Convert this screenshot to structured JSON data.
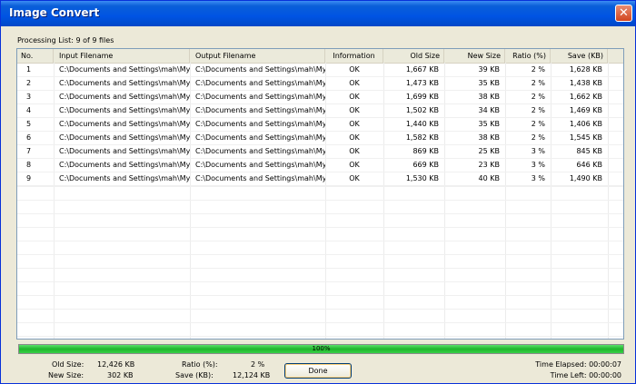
{
  "window": {
    "title": "Image Convert"
  },
  "processing_label": "Processing List: 9 of 9 files",
  "table": {
    "columns": [
      "No.",
      "Input Filename",
      "Output Filename",
      "Information",
      "Old Size",
      "New Size",
      "Ratio (%)",
      "Save (KB)"
    ],
    "rows": [
      [
        "1",
        "C:\\Documents and Settings\\mah\\My ...",
        "C:\\Documents and Settings\\mah\\My ...",
        "OK",
        "1,667 KB",
        "39 KB",
        "2 %",
        "1,628 KB"
      ],
      [
        "2",
        "C:\\Documents and Settings\\mah\\My ...",
        "C:\\Documents and Settings\\mah\\My ...",
        "OK",
        "1,473 KB",
        "35 KB",
        "2 %",
        "1,438 KB"
      ],
      [
        "3",
        "C:\\Documents and Settings\\mah\\My ...",
        "C:\\Documents and Settings\\mah\\My ...",
        "OK",
        "1,699 KB",
        "38 KB",
        "2 %",
        "1,662 KB"
      ],
      [
        "4",
        "C:\\Documents and Settings\\mah\\My ...",
        "C:\\Documents and Settings\\mah\\My ...",
        "OK",
        "1,502 KB",
        "34 KB",
        "2 %",
        "1,469 KB"
      ],
      [
        "5",
        "C:\\Documents and Settings\\mah\\My ...",
        "C:\\Documents and Settings\\mah\\My ...",
        "OK",
        "1,440 KB",
        "35 KB",
        "2 %",
        "1,406 KB"
      ],
      [
        "6",
        "C:\\Documents and Settings\\mah\\My ...",
        "C:\\Documents and Settings\\mah\\My ...",
        "OK",
        "1,582 KB",
        "38 KB",
        "2 %",
        "1,545 KB"
      ],
      [
        "7",
        "C:\\Documents and Settings\\mah\\My ...",
        "C:\\Documents and Settings\\mah\\My ...",
        "OK",
        "869 KB",
        "25 KB",
        "3 %",
        "845 KB"
      ],
      [
        "8",
        "C:\\Documents and Settings\\mah\\My ...",
        "C:\\Documents and Settings\\mah\\My ...",
        "OK",
        "669 KB",
        "23 KB",
        "3 %",
        "646 KB"
      ],
      [
        "9",
        "C:\\Documents and Settings\\mah\\My ...",
        "C:\\Documents and Settings\\mah\\My ...",
        "OK",
        "1,530 KB",
        "40 KB",
        "3 %",
        "1,490 KB"
      ]
    ]
  },
  "progress": {
    "value": 1.0,
    "label": "100%"
  },
  "stats": {
    "old_size_label": "Old Size:",
    "old_size_value": "12,426 KB",
    "new_size_label": "New Size:",
    "new_size_value": "302 KB",
    "ratio_label": "Ratio (%):",
    "ratio_value": "2 %",
    "save_label": "Save (KB):",
    "save_value": "12,124 KB",
    "time_elapsed": "Time Elapsed: 00:00:07",
    "time_left": "Time Left: 00:00:00"
  },
  "buttons": {
    "done": "Done"
  },
  "icons": {
    "close": "close-icon"
  },
  "colors": {
    "titlebar": "#0054e3",
    "progress": "#1fb62b",
    "close": "#d2451f"
  }
}
